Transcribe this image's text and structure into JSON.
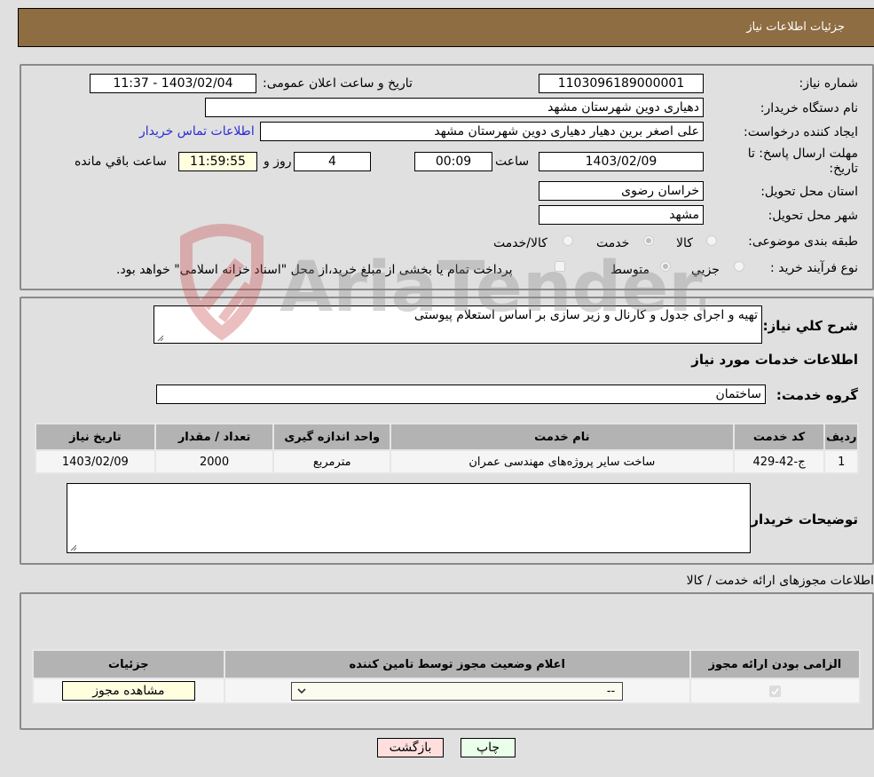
{
  "header": {
    "title": "جزئیات اطلاعات نیاز"
  },
  "details": {
    "need_number_label": "شماره نیاز:",
    "need_number": "1103096189000001",
    "announce_label": "تاریخ و ساعت اعلان عمومی:",
    "announce_value": "1403/02/04 - 11:37",
    "buyer_org_label": "نام دستگاه خریدار:",
    "buyer_org": "دهیاری دوین  شهرستان مشهد",
    "creator_label": "ایجاد کننده درخواست:",
    "creator": "علی اصغر برین دهیار دهیاری دوین  شهرستان مشهد",
    "contact_link": "اطلاعات تماس خریدار",
    "deadline_label": "مهلت ارسال پاسخ: تا تاریخ:",
    "deadline_date": "1403/02/09",
    "time_label": "ساعت",
    "deadline_time": "00:09",
    "days_value": "4",
    "days_label": "روز و",
    "remaining_time": "11:59:55",
    "remaining_label": "ساعت باقي مانده",
    "province_label": "استان محل تحویل:",
    "province": "خراسان رضوی",
    "city_label": "شهر محل تحویل:",
    "city": "مشهد",
    "category_label": "طبقه بندی موضوعی:",
    "category_options": [
      {
        "label": "کالا",
        "checked": false
      },
      {
        "label": "خدمت",
        "checked": true
      },
      {
        "label": "کالا/خدمت",
        "checked": false
      }
    ],
    "process_label": "نوع فرآیند خرید :",
    "process_options": [
      {
        "label": "جزيي",
        "checked": false
      },
      {
        "label": "متوسط",
        "checked": true
      }
    ],
    "treasury_note": "پرداخت تمام یا بخشی از مبلغ خرید،از محل \"اسناد خزانه اسلامی\" خواهد بود.",
    "treasury_checked": false
  },
  "services": {
    "description_label": "شرح کلي نیاز:",
    "description": "تهیه و اجرای جدول و کارنال و زیر سازی بر اساس استعلام پیوستی",
    "section_title": "اطلاعات خدمات مورد نیاز",
    "group_label": "گروه خدمت:",
    "group_value": "ساختمان",
    "table": {
      "headers": [
        "ردیف",
        "کد خدمت",
        "نام خدمت",
        "واحد اندازه گیری",
        "تعداد / مقدار",
        "تاریخ نیاز"
      ],
      "rows": [
        [
          "1",
          "ج-42-429",
          "ساخت سایر پروژه‌های مهندسی عمران",
          "مترمربع",
          "2000",
          "1403/02/09"
        ]
      ]
    },
    "buyer_notes_label": "توضیحات خریدار:",
    "buyer_notes": ""
  },
  "permits": {
    "section_title": "اطلاعات مجوزهای ارائه خدمت / کالا",
    "headers": [
      "الزامی بودن ارائه مجوز",
      "اعلام وضعیت مجوز توسط تامین کننده",
      "جزئیات"
    ],
    "row": {
      "required_checked": true,
      "status_selected": "--",
      "details_button": "مشاهده مجوز"
    }
  },
  "footer": {
    "print_button": "چاپ",
    "back_button": "بازگشت"
  },
  "watermark": {
    "text": "AriaTender.neT"
  },
  "colors": {
    "header_bg": "#8f6d42",
    "print_bg": "#eaffea",
    "back_bg": "#ffdede",
    "link": "#2a2ad6",
    "remaining_bg": "#ffffe0"
  }
}
